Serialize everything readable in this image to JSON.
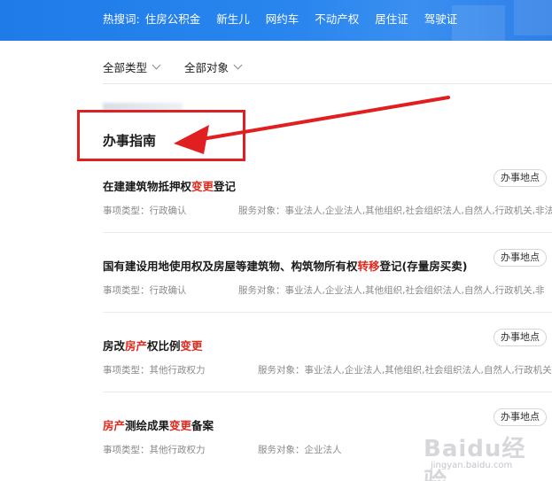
{
  "hot_search": {
    "label": "热搜词:",
    "links": [
      "住房公积金",
      "新生儿",
      "网约车",
      "不动产权",
      "居住证",
      "驾驶证"
    ]
  },
  "filters": {
    "type_label": "全部类型",
    "target_label": "全部对象"
  },
  "section": {
    "title": "办事指南"
  },
  "items": [
    {
      "title_parts": [
        {
          "t": "在建建筑物抵押权",
          "hl": false
        },
        {
          "t": "变更",
          "hl": true
        },
        {
          "t": "登记",
          "hl": false
        }
      ],
      "location_button": "办事地点",
      "type_text": "事项类型：行政确认",
      "target_text": "服务对象：事业法人,企业法人,其他组织,社会组织法人,自然人,行政机关,非法"
    },
    {
      "title_parts": [
        {
          "t": "国有建设用地使用权及房屋等建筑物、构筑物所有权",
          "hl": false
        },
        {
          "t": "转移",
          "hl": true
        },
        {
          "t": "登记(存量房买卖)",
          "hl": false
        }
      ],
      "location_button": "办事地点",
      "type_text": "事项类型：行政确认",
      "target_text": "服务对象：事业法人,企业法人,其他组织,社会组织法人,自然人,行政机关,非"
    },
    {
      "title_parts": [
        {
          "t": "房改",
          "hl": false
        },
        {
          "t": "房产",
          "hl": true
        },
        {
          "t": "权比例",
          "hl": false
        },
        {
          "t": "变更",
          "hl": true
        }
      ],
      "location_button": "办事地点",
      "type_text": "事项类型：其他行政权力",
      "target_text": "服务对象：事业法人,企业法人,其他组织,社会组织法人,自然人,行政机关,"
    },
    {
      "title_parts": [
        {
          "t": "房产",
          "hl": true
        },
        {
          "t": "测绘成果",
          "hl": false
        },
        {
          "t": "变更",
          "hl": true
        },
        {
          "t": "备案",
          "hl": false
        }
      ],
      "location_button": "办事地点",
      "type_text": "事项类型：其他行政权力",
      "target_text": "服务对象：企业法人"
    }
  ],
  "watermark": {
    "main": "Baidu经验",
    "sub": "jingyan.baidu.com"
  },
  "colors": {
    "hotbar": "#1e7be8",
    "highlight": "#e0281d",
    "annotation": "#e02020"
  }
}
